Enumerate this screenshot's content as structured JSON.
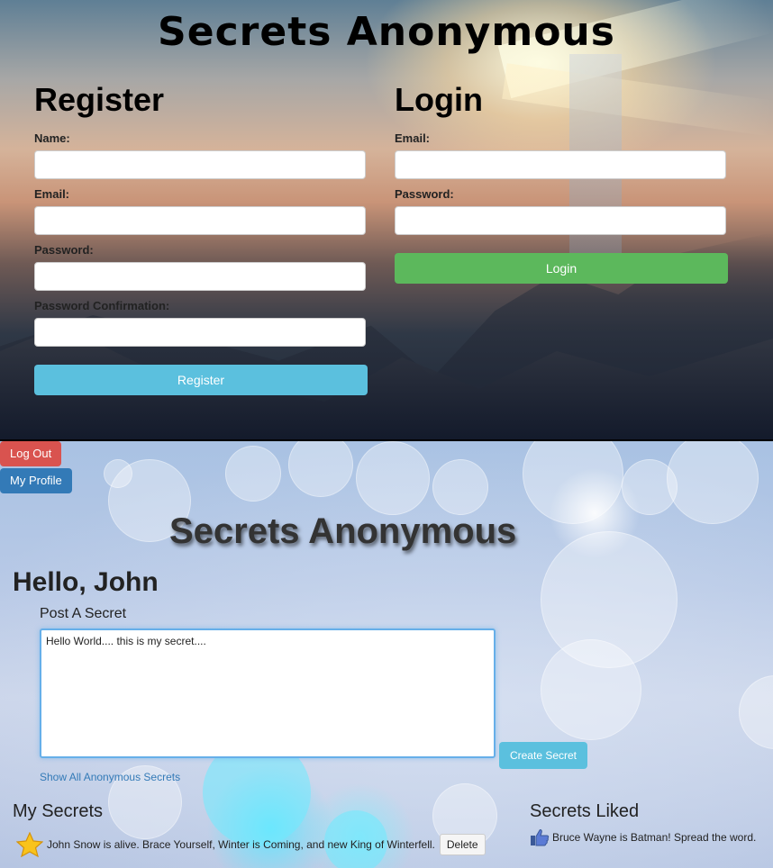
{
  "top": {
    "title": "Secrets Anonymous",
    "register": {
      "heading": "Register",
      "name_label": "Name:",
      "email_label": "Email:",
      "password_label": "Password:",
      "password_confirm_label": "Password Confirmation:",
      "name_value": "",
      "email_value": "",
      "password_value": "",
      "password_confirm_value": "",
      "button_label": "Register",
      "button_color": "#5bc0de"
    },
    "login": {
      "heading": "Login",
      "email_label": "Email:",
      "password_label": "Password:",
      "email_value": "",
      "password_value": "",
      "button_label": "Login",
      "button_color": "#5cb85c"
    }
  },
  "bottom": {
    "logout_label": "Log Out",
    "logout_color": "#d9534f",
    "profile_label": "My Profile",
    "profile_color": "#337ab7",
    "title": "Secrets Anonymous",
    "greeting": "Hello, John",
    "post_label": "Post A Secret",
    "secret_text": "Hello World.... this is my secret....",
    "create_label": "Create Secret",
    "show_all_label": "Show All Anonymous Secrets",
    "my_secrets_heading": "My Secrets",
    "my_secrets": [
      {
        "icon": "star-icon",
        "text": "John Snow is alive. Brace Yourself, Winter is Coming, and new King of Winterfell.",
        "delete_label": "Delete"
      }
    ],
    "liked_heading": "Secrets Liked",
    "liked": [
      {
        "icon": "thumbs-up-icon",
        "text": "Bruce Wayne is Batman! Spread the word."
      }
    ]
  }
}
